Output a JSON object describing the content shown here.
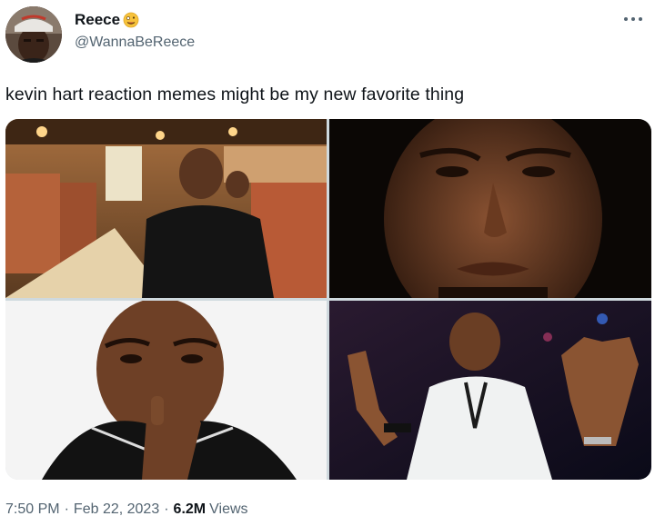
{
  "author": {
    "display_name": "Reece",
    "emoji_icon": "zany-face-emoji",
    "handle": "@WannaBeReece"
  },
  "menu_icon": "more-horizontal-icon",
  "tweet": {
    "text": "kevin hart reaction memes might be my new favorite thing"
  },
  "media": {
    "count": 4
  },
  "footer": {
    "time": "7:50 PM",
    "separator": "·",
    "date": "Feb 22, 2023",
    "views_count": "6.2M",
    "views_label": "Views"
  },
  "colors": {
    "text_primary": "#0f1419",
    "text_secondary": "#536471",
    "background": "#ffffff"
  }
}
